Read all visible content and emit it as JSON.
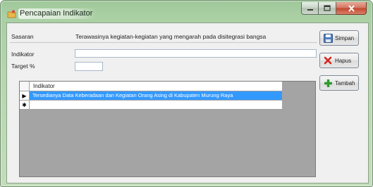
{
  "window": {
    "title": "Pencapaian Indikator"
  },
  "form": {
    "sasaran_label": "Sasaran",
    "sasaran_value": "Terawasinya kegiatan-kegiatan yang mengarah pada disitegrasi bangsa",
    "indikator_label": "Indikator",
    "indikator_value": "",
    "target_label": "Target %",
    "target_value": ""
  },
  "grid": {
    "column": "Indikator",
    "rows": [
      {
        "marker": "▶",
        "value": "Tersedianya Data Keberadaan dan Kegiatan Orang Asing di Kabupaten Murung Raya"
      },
      {
        "marker": "✱",
        "value": ""
      }
    ]
  },
  "buttons": {
    "simpan": "Simpan",
    "hapus": "Hapus",
    "tambah": "Tambah"
  },
  "colors": {
    "selection": "#3399ff",
    "grid_background": "#a4a4a4"
  }
}
